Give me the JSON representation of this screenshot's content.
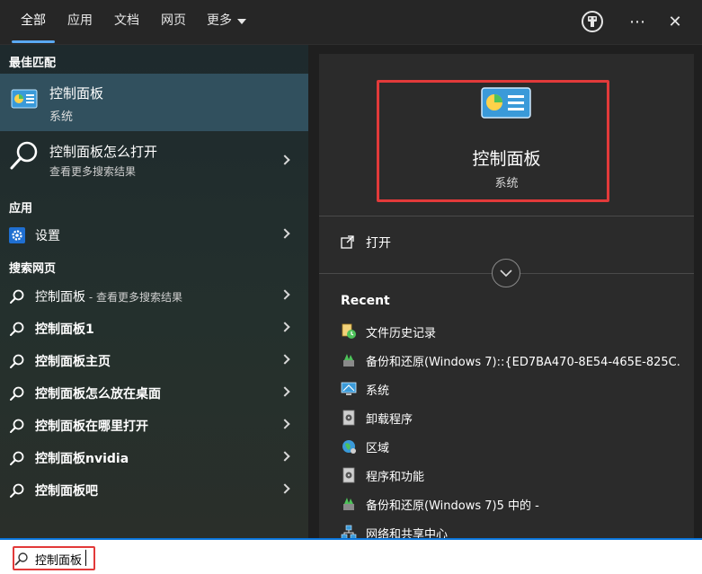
{
  "tabs": [
    {
      "label": "全部",
      "active": true
    },
    {
      "label": "应用"
    },
    {
      "label": "文档"
    },
    {
      "label": "网页"
    },
    {
      "label": "更多"
    }
  ],
  "top_icons": {
    "more": "⋯",
    "close": "✕"
  },
  "left": {
    "best_match_heading": "最佳匹配",
    "best_match": {
      "title": "控制面板",
      "subtitle": "系统"
    },
    "search_item": {
      "title": "控制面板怎么打开",
      "subtitle": "查看更多搜索结果"
    },
    "apps_heading": "应用",
    "apps": [
      {
        "label": "设置"
      }
    ],
    "web_heading": "搜索网页",
    "web_results": [
      {
        "label": "控制面板",
        "suffix": " - 查看更多搜索结果"
      },
      {
        "label": "控制面板1",
        "suffix": ""
      },
      {
        "label": "控制面板主页",
        "suffix": ""
      },
      {
        "label": "控制面板怎么放在桌面",
        "suffix": ""
      },
      {
        "label": "控制面板在哪里打开",
        "suffix": ""
      },
      {
        "label": "控制面板nvidia",
        "suffix": ""
      },
      {
        "label": "控制面板吧",
        "suffix": ""
      }
    ]
  },
  "right": {
    "title": "控制面板",
    "subtitle": "系统",
    "open_label": "打开",
    "recent_heading": "Recent",
    "recent": [
      {
        "label": "文件历史记录",
        "icon": "file-history-icon"
      },
      {
        "label": "备份和还原(Windows 7)::{ED7BA470-8E54-465E-825C...",
        "icon": "backup-icon"
      },
      {
        "label": "系统",
        "icon": "system-icon"
      },
      {
        "label": "卸载程序",
        "icon": "uninstall-icon"
      },
      {
        "label": "区域",
        "icon": "region-icon"
      },
      {
        "label": "程序和功能",
        "icon": "programs-icon"
      },
      {
        "label": "备份和还原(Windows 7)5 中的 -",
        "icon": "backup-icon"
      },
      {
        "label": "网络和共享中心",
        "icon": "network-icon"
      }
    ]
  },
  "search": {
    "value": "控制面板"
  },
  "colors": {
    "accent": "#5aa9f2",
    "highlight_box": "#e23a3a",
    "selected_row": "#31505e",
    "search_border": "#0a74d9"
  }
}
